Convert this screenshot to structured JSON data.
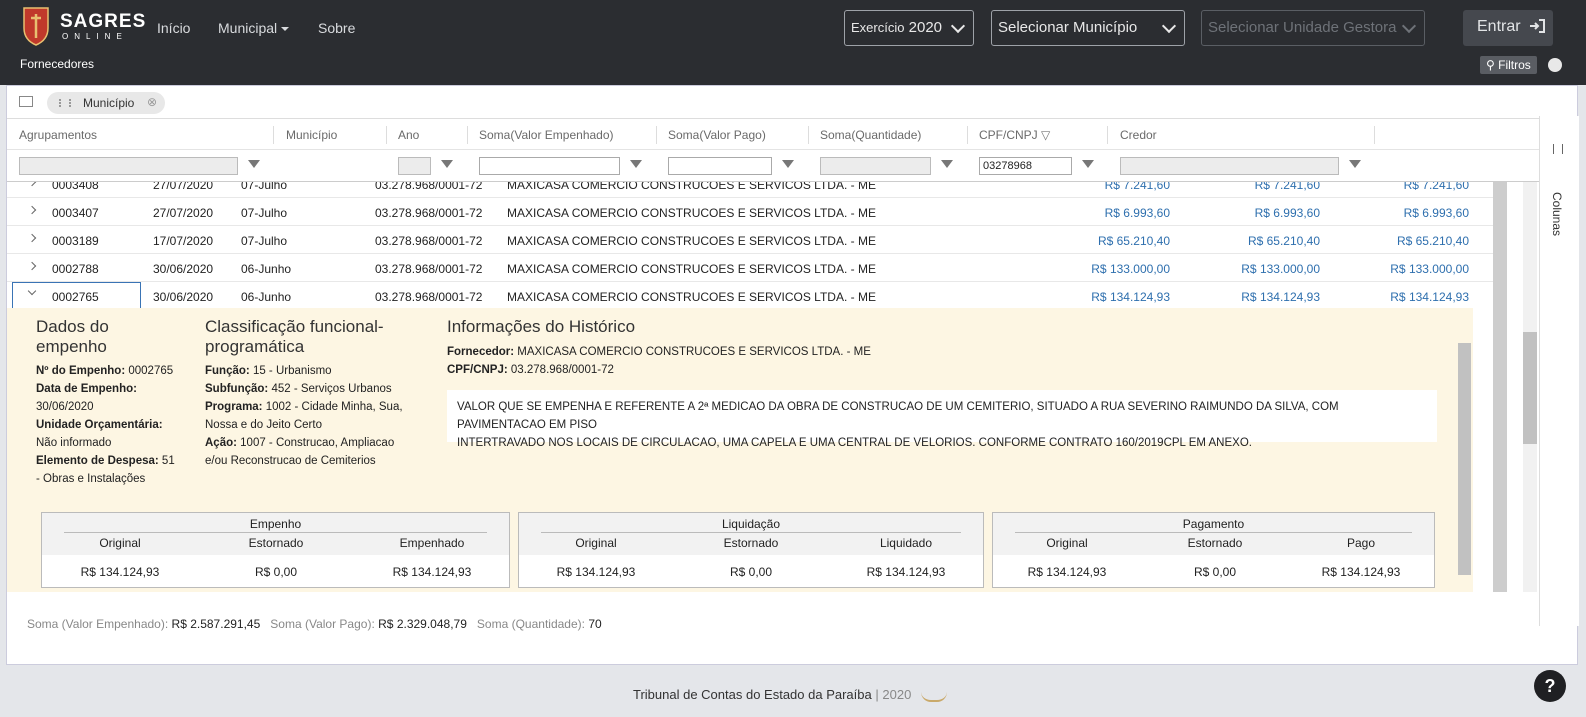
{
  "nav": {
    "brand_main": "SAGRES",
    "brand_sub": "ONLINE",
    "links": [
      {
        "label": "Início"
      },
      {
        "label": "Municipal"
      },
      {
        "label": "Sobre"
      }
    ],
    "exercicio_label": "Exercício",
    "exercicio_value": "2020",
    "municipio_placeholder": "Selecionar Município",
    "unidade_placeholder": "Selecionar Unidade Gestora",
    "login_label": "Entrar"
  },
  "subheader": {
    "title": "Fornecedores",
    "filters_label": "Filtros"
  },
  "grouping": {
    "chip_label": "Município"
  },
  "columns": {
    "agrupamentos": "Agrupamentos",
    "municipio": "Município",
    "ano": "Ano",
    "soma_valor_empenhado": "Soma(Valor Empenhado)",
    "soma_valor_pago": "Soma(Valor Pago)",
    "soma_quantidade": "Soma(Quantidade)",
    "cpf_cnpj": "CPF/CNPJ",
    "credor": "Credor"
  },
  "filters": {
    "cpf_cnpj_value": "03278968"
  },
  "rows": [
    {
      "numero": "0003408",
      "data": "27/07/2020",
      "mes": "07-Julho",
      "cnpj": "03.278.968/0001-72",
      "credor": "MAXICASA COMERCIO CONSTRUCOES E SERVICOS LTDA. - ME",
      "v1": "R$ 7.241,60",
      "v2": "R$ 7.241,60",
      "v3": "R$ 7.241,60"
    },
    {
      "numero": "0003407",
      "data": "27/07/2020",
      "mes": "07-Julho",
      "cnpj": "03.278.968/0001-72",
      "credor": "MAXICASA COMERCIO CONSTRUCOES E SERVICOS LTDA. - ME",
      "v1": "R$ 6.993,60",
      "v2": "R$ 6.993,60",
      "v3": "R$ 6.993,60"
    },
    {
      "numero": "0003189",
      "data": "17/07/2020",
      "mes": "07-Julho",
      "cnpj": "03.278.968/0001-72",
      "credor": "MAXICASA COMERCIO CONSTRUCOES E SERVICOS LTDA. - ME",
      "v1": "R$ 65.210,40",
      "v2": "R$ 65.210,40",
      "v3": "R$ 65.210,40"
    },
    {
      "numero": "0002788",
      "data": "30/06/2020",
      "mes": "06-Junho",
      "cnpj": "03.278.968/0001-72",
      "credor": "MAXICASA COMERCIO CONSTRUCOES E SERVICOS LTDA. - ME",
      "v1": "R$ 133.000,00",
      "v2": "R$ 133.000,00",
      "v3": "R$ 133.000,00"
    },
    {
      "numero": "0002765",
      "data": "30/06/2020",
      "mes": "06-Junho",
      "cnpj": "03.278.968/0001-72",
      "credor": "MAXICASA COMERCIO CONSTRUCOES E SERVICOS LTDA. - ME",
      "v1": "R$ 134.124,93",
      "v2": "R$ 134.124,93",
      "v3": "R$ 134.124,93"
    }
  ],
  "detail": {
    "dados_title_1": "Dados do",
    "dados_title_2": "empenho",
    "n_empenho_label": "Nº do Empenho:",
    "n_empenho_value": "0002765",
    "data_empenho_label": "Data de Empenho:",
    "data_empenho_value": "30/06/2020",
    "unidade_label": "Unidade Orçamentária:",
    "unidade_value": "Não informado",
    "elemento_label": "Elemento de Despesa:",
    "elemento_value_1": "51",
    "elemento_value_2": "- Obras e Instalações",
    "class_title_1": "Classificação funcional-",
    "class_title_2": "programática",
    "funcao_label": "Função:",
    "funcao_value": "15 - Urbanismo",
    "subfuncao_label": "Subfunção:",
    "subfuncao_value": "452 - Serviços Urbanos",
    "programa_label": "Programa:",
    "programa_value_1": "1002 - Cidade Minha, Sua,",
    "programa_value_2": "Nossa e do Jeito Certo",
    "acao_label": "Ação:",
    "acao_value_1": "1007 - Construcao, Ampliacao",
    "acao_value_2": "e/ou Reconstrucao de Cemiterios",
    "hist_title": "Informações do Histórico",
    "fornecedor_label": "Fornecedor:",
    "fornecedor_value": "MAXICASA COMERCIO CONSTRUCOES E SERVICOS LTDA. - ME",
    "cpf_label": "CPF/CNPJ:",
    "cpf_value": "03.278.968/0001-72",
    "historico_1": "VALOR QUE SE EMPENHA E REFERENTE A 2ª MEDICAO DA OBRA DE CONSTRUCAO DE UM CEMITERIO, SITUADO A RUA SEVERINO RAIMUNDO DA SILVA, COM PAVIMENTACAO EM PISO",
    "historico_2": "INTERTRAVADO NOS LOCAIS DE CIRCULACAO, UMA CAPELA E UMA CENTRAL DE VELORIOS. CONFORME CONTRATO 160/2019CPL EM ANEXO.",
    "empenho": {
      "title": "Empenho",
      "c1": "Original",
      "c2": "Estornado",
      "c3": "Empenhado",
      "v1": "R$ 134.124,93",
      "v2": "R$ 0,00",
      "v3": "R$ 134.124,93"
    },
    "liquidacao": {
      "title": "Liquidação",
      "c1": "Original",
      "c2": "Estornado",
      "c3": "Liquidado",
      "v1": "R$ 134.124,93",
      "v2": "R$ 0,00",
      "v3": "R$ 134.124,93"
    },
    "pagamento": {
      "title": "Pagamento",
      "c1": "Original",
      "c2": "Estornado",
      "c3": "Pago",
      "v1": "R$ 134.124,93",
      "v2": "R$ 0,00",
      "v3": "R$ 134.124,93"
    }
  },
  "side_label": "Colunas",
  "totals": {
    "emp_label": "Soma (Valor Empenhado):",
    "emp_value": "R$ 2.587.291,45",
    "pago_label": "Soma (Valor Pago):",
    "pago_value": "R$ 2.329.048,79",
    "qtd_label": "Soma (Quantidade):",
    "qtd_value": "70"
  },
  "footer": {
    "org": "Tribunal de Contas do Estado da Paraíba",
    "sep": "|",
    "year": "2020"
  },
  "help_label": "?",
  "colors": {
    "navbar": "#2b2d31",
    "money": "#2e6fae",
    "detail_bg": "#fdf6e3"
  }
}
